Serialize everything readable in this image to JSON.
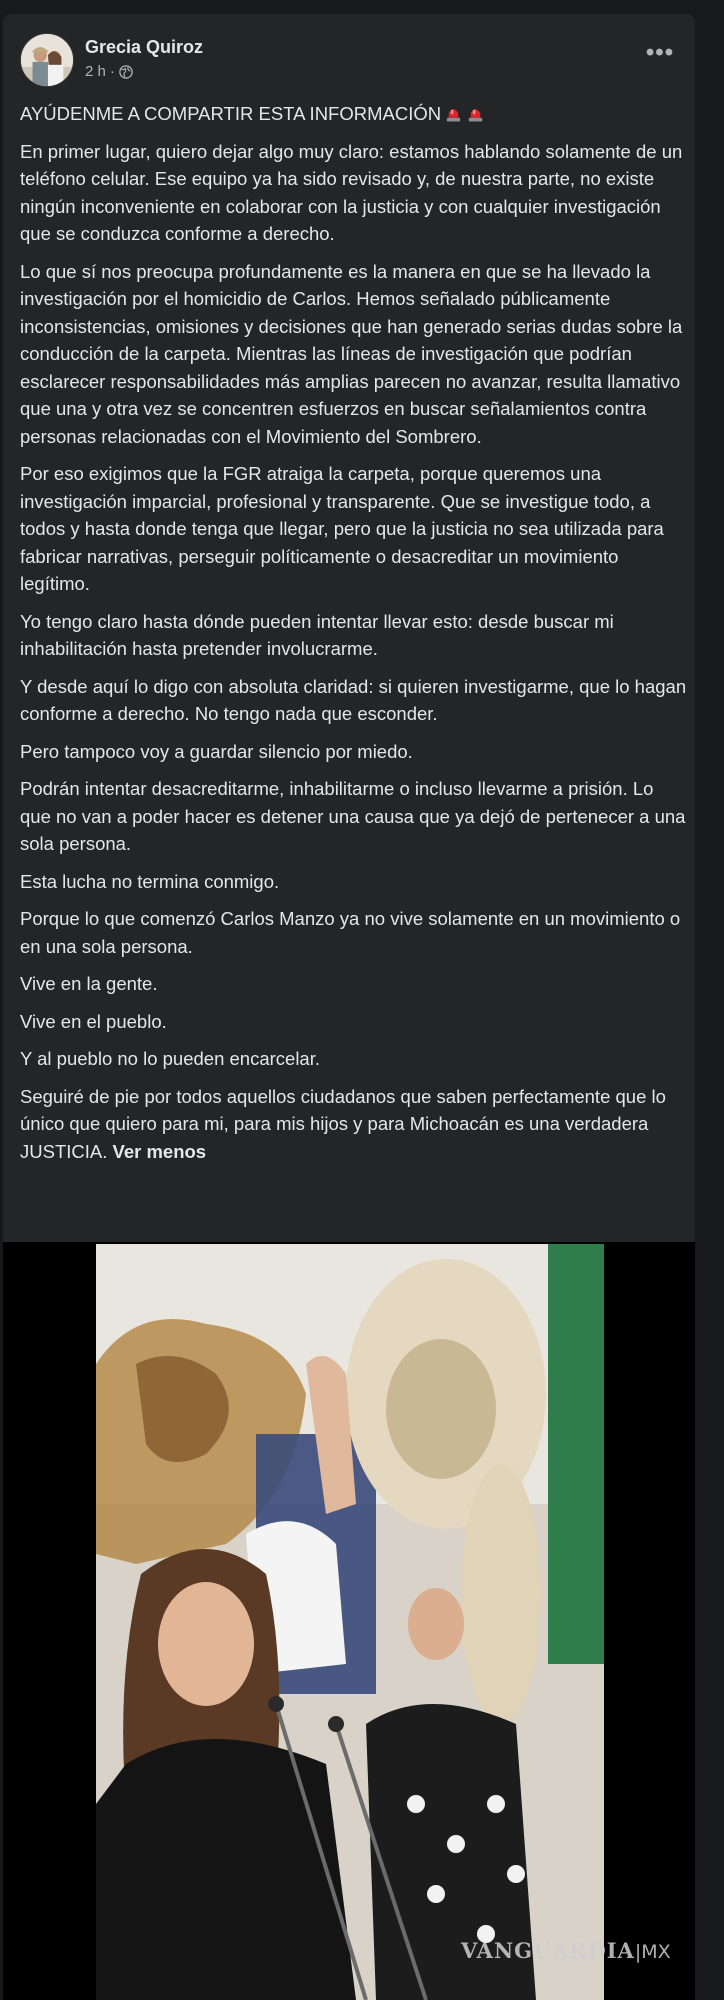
{
  "post": {
    "author": "Grecia Quiroz",
    "time": "2 h",
    "privacy_icon": "globe-icon",
    "more_icon": "more-options-icon",
    "more_glyph": "•••",
    "headline": "AYÚDENME A COMPARTIR ESTA INFORMACIÓN",
    "headline_emoji": "siren-emoji",
    "paragraphs": [
      "En primer lugar, quiero dejar algo muy claro: estamos hablando solamente de un teléfono celular. Ese equipo ya ha sido revisado y, de nuestra parte, no existe ningún inconveniente en colaborar con la justicia y con cualquier investigación que se conduzca conforme a derecho.",
      "Lo que sí nos preocupa profundamente es la manera en que se ha llevado la investigación por el homicidio de Carlos. Hemos señalado públicamente inconsistencias, omisiones y decisiones que han generado serias dudas sobre la conducción de la carpeta. Mientras las líneas de investigación que podrían esclarecer responsabilidades más amplias parecen no avanzar, resulta llamativo que una y otra vez se concentren esfuerzos en buscar señalamientos contra personas relacionadas con el Movimiento del Sombrero.",
      "Por eso exigimos que la FGR atraiga la carpeta, porque queremos una investigación imparcial, profesional y transparente. Que se investigue todo, a todos y hasta donde tenga que llegar, pero que la justicia no sea utilizada para fabricar narrativas, perseguir políticamente o desacreditar un movimiento legítimo.",
      "Yo tengo claro hasta dónde pueden intentar llevar esto: desde buscar mi inhabilitación hasta pretender involucrarme.",
      "Y desde aquí lo digo con absoluta claridad: si quieren investigarme, que lo hagan conforme a derecho. No tengo nada que esconder.",
      "Pero tampoco voy a guardar silencio por miedo.",
      "Podrán intentar desacreditarme, inhabilitarme o incluso llevarme a prisión. Lo que no van a poder hacer es detener una causa que ya dejó de pertenecer a una sola persona.",
      "Esta lucha no termina conmigo.",
      "Porque lo que comenzó Carlos Manzo ya no vive solamente en un movimiento o en una sola persona.",
      "Vive en la gente.",
      "Vive en el pueblo.",
      "Y al pueblo no lo pueden encarcelar."
    ],
    "last_paragraph": "Seguiré de pie por todos aquellos ciudadanos que saben perfectamente que lo único que quiero para mi, para mis hijos y para Michoacán es una verdadera JUSTICIA.",
    "see_less": "Ver menos"
  },
  "media": {
    "watermark_main": "VANGUARDIA",
    "watermark_suffix": "|MX"
  },
  "colors": {
    "page_bg": "#18191a",
    "card_bg": "#242526",
    "primary_text": "#e4e6eb",
    "secondary_text": "#b0b3b8"
  }
}
